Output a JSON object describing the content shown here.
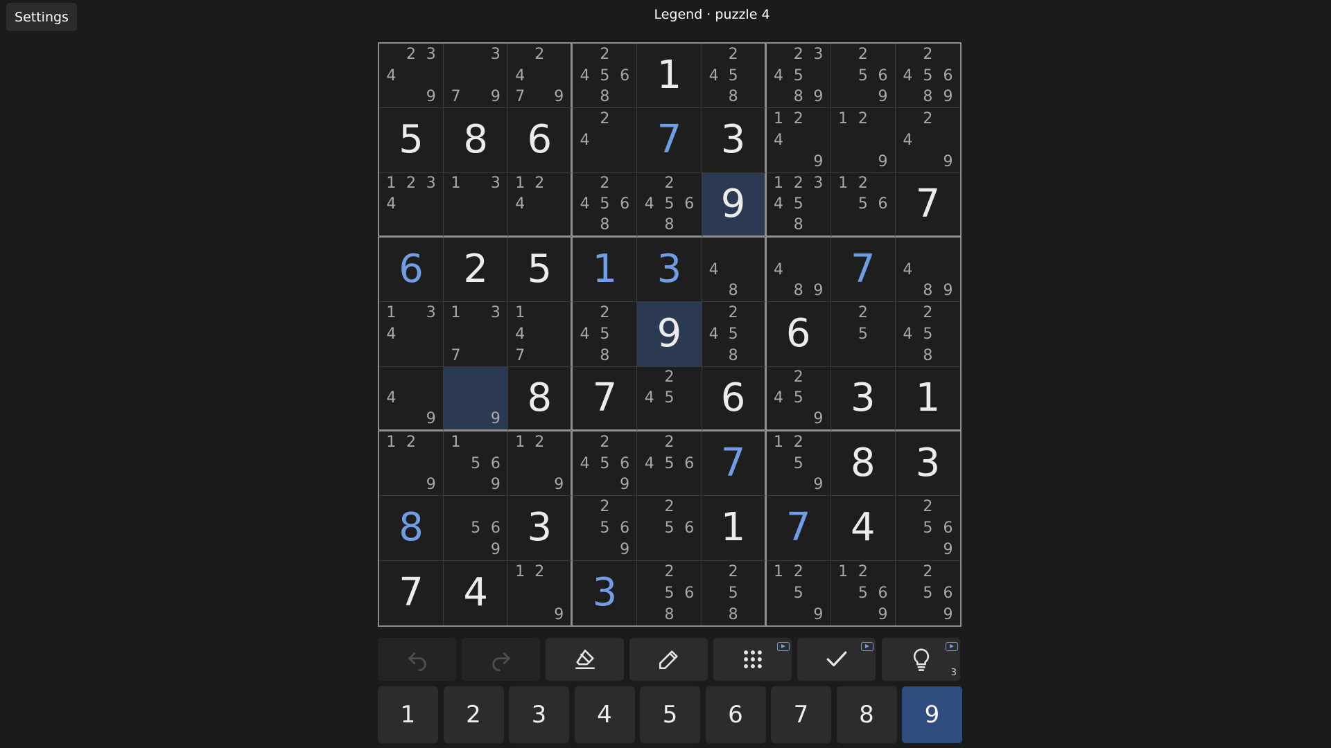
{
  "header": {
    "settings_label": "Settings",
    "title": "Legend · puzzle 4"
  },
  "theme": {
    "background": "#1b1b1b",
    "given_color": "#ececec",
    "user_color": "#6f9ee6",
    "note_color": "#a8a8a8",
    "highlight_color": "#2b3a52",
    "active_key_color": "#2f4d7f"
  },
  "board": {
    "highlighted_digit": 9,
    "cells": [
      [
        {
          "n": [
            2,
            3,
            4,
            9
          ]
        },
        {
          "n": [
            3,
            7,
            9
          ]
        },
        {
          "n": [
            2,
            4,
            7,
            9
          ]
        },
        {
          "n": [
            2,
            4,
            5,
            6,
            8
          ]
        },
        {
          "v": 1,
          "g": true
        },
        {
          "n": [
            2,
            4,
            5,
            8
          ]
        },
        {
          "n": [
            2,
            3,
            4,
            5,
            8,
            9
          ]
        },
        {
          "n": [
            2,
            5,
            6,
            9
          ]
        },
        {
          "n": [
            2,
            4,
            5,
            6,
            8,
            9
          ]
        }
      ],
      [
        {
          "v": 5,
          "g": true
        },
        {
          "v": 8,
          "g": true
        },
        {
          "v": 6,
          "g": true
        },
        {
          "n": [
            2,
            4
          ]
        },
        {
          "v": 7,
          "g": false
        },
        {
          "v": 3,
          "g": true
        },
        {
          "n": [
            1,
            2,
            4,
            9
          ]
        },
        {
          "n": [
            1,
            2,
            9
          ]
        },
        {
          "n": [
            2,
            4,
            9
          ]
        }
      ],
      [
        {
          "n": [
            1,
            2,
            3,
            4
          ]
        },
        {
          "n": [
            1,
            3
          ]
        },
        {
          "n": [
            1,
            2,
            4
          ]
        },
        {
          "n": [
            2,
            4,
            5,
            6,
            8
          ]
        },
        {
          "n": [
            2,
            4,
            5,
            6,
            8
          ]
        },
        {
          "v": 9,
          "g": true
        },
        {
          "n": [
            1,
            2,
            3,
            4,
            5,
            8
          ]
        },
        {
          "n": [
            1,
            2,
            5,
            6
          ]
        },
        {
          "v": 7,
          "g": true
        }
      ],
      [
        {
          "v": 6,
          "g": false
        },
        {
          "v": 2,
          "g": true
        },
        {
          "v": 5,
          "g": true
        },
        {
          "v": 1,
          "g": false
        },
        {
          "v": 3,
          "g": false
        },
        {
          "n": [
            4,
            8
          ]
        },
        {
          "n": [
            4,
            8,
            9
          ]
        },
        {
          "v": 7,
          "g": false
        },
        {
          "n": [
            4,
            8,
            9
          ]
        }
      ],
      [
        {
          "n": [
            1,
            3,
            4
          ]
        },
        {
          "n": [
            1,
            3,
            7
          ]
        },
        {
          "n": [
            1,
            4,
            7
          ]
        },
        {
          "n": [
            2,
            4,
            5,
            8
          ]
        },
        {
          "v": 9,
          "g": true
        },
        {
          "n": [
            2,
            4,
            5,
            8
          ]
        },
        {
          "v": 6,
          "g": true
        },
        {
          "n": [
            2,
            5
          ]
        },
        {
          "n": [
            2,
            4,
            5,
            8
          ]
        }
      ],
      [
        {
          "n": [
            4,
            9
          ]
        },
        {
          "n": [
            9
          ]
        },
        {
          "v": 8,
          "g": true
        },
        {
          "v": 7,
          "g": true
        },
        {
          "n": [
            2,
            4,
            5
          ]
        },
        {
          "v": 6,
          "g": true
        },
        {
          "n": [
            2,
            4,
            5,
            9
          ]
        },
        {
          "v": 3,
          "g": true
        },
        {
          "v": 1,
          "g": true
        }
      ],
      [
        {
          "n": [
            1,
            2,
            9
          ]
        },
        {
          "n": [
            1,
            5,
            6,
            9
          ]
        },
        {
          "n": [
            1,
            2,
            9
          ]
        },
        {
          "n": [
            2,
            4,
            5,
            6,
            9
          ]
        },
        {
          "n": [
            2,
            4,
            5,
            6
          ]
        },
        {
          "v": 7,
          "g": false
        },
        {
          "n": [
            1,
            2,
            5,
            9
          ]
        },
        {
          "v": 8,
          "g": true
        },
        {
          "v": 3,
          "g": true
        }
      ],
      [
        {
          "v": 8,
          "g": false
        },
        {
          "n": [
            5,
            6,
            9
          ]
        },
        {
          "v": 3,
          "g": true
        },
        {
          "n": [
            2,
            5,
            6,
            9
          ]
        },
        {
          "n": [
            2,
            5,
            6
          ]
        },
        {
          "v": 1,
          "g": true
        },
        {
          "v": 7,
          "g": false
        },
        {
          "v": 4,
          "g": true
        },
        {
          "n": [
            2,
            5,
            6,
            9
          ]
        }
      ],
      [
        {
          "v": 7,
          "g": true
        },
        {
          "v": 4,
          "g": true
        },
        {
          "n": [
            1,
            2,
            9
          ]
        },
        {
          "v": 3,
          "g": false
        },
        {
          "n": [
            2,
            5,
            6,
            8
          ]
        },
        {
          "n": [
            2,
            5,
            8
          ]
        },
        {
          "n": [
            1,
            2,
            5,
            9
          ]
        },
        {
          "n": [
            1,
            2,
            5,
            6,
            9
          ]
        },
        {
          "n": [
            2,
            5,
            6,
            9
          ]
        }
      ]
    ]
  },
  "toolbar": [
    {
      "name": "undo-button",
      "icon": "undo-icon",
      "disabled": true
    },
    {
      "name": "redo-button",
      "icon": "redo-icon",
      "disabled": true
    },
    {
      "name": "erase-button",
      "icon": "eraser-icon"
    },
    {
      "name": "pencil-button",
      "icon": "pencil-icon"
    },
    {
      "name": "auto-notes-button",
      "icon": "grid-dots-icon",
      "ad": true
    },
    {
      "name": "check-button",
      "icon": "check-icon",
      "ad": true
    },
    {
      "name": "hint-button",
      "icon": "lightbulb-icon",
      "ad": true,
      "count": "3"
    }
  ],
  "numpad": {
    "keys": [
      "1",
      "2",
      "3",
      "4",
      "5",
      "6",
      "7",
      "8",
      "9"
    ],
    "active": "9"
  }
}
